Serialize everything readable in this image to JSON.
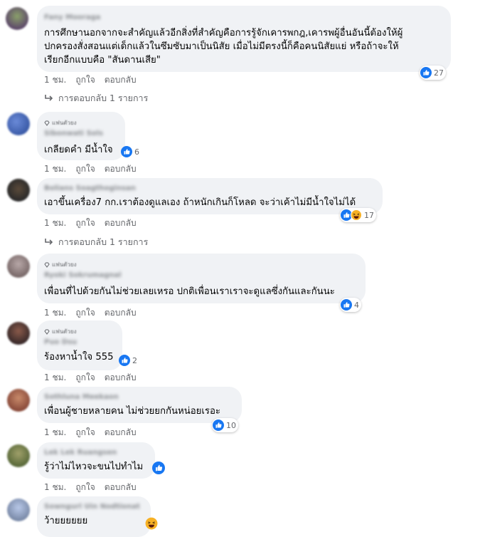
{
  "actions": {
    "time": "1 ชม.",
    "like": "ถูกใจ",
    "reply": "ตอบกลับ"
  },
  "comments": [
    {
      "author": "Fany Mooraga",
      "badge": "",
      "lines": [
        "การศึกษานอกจากจะสำคัญแล้วอีกสิ่งที่สำคัญคือการรู้จักเคารพกฎ,เคารพผู้อื่นอันนี้ต้องให้ผู้",
        "ปกครองสั่งสอนแต่เด็กแล้วในซึมซับมาเป็นนิสัย เมื่อไม่มีตรงนี้ก็คือคนนิสัยแย่ หรือถ้าจะให้",
        "เรียกอีกแบบคือ \"สันดานเสีย\""
      ],
      "reaction_count": "27",
      "replies_label": "การตอบกลับ 1 รายการ"
    },
    {
      "author": "Sibonwati Sols",
      "badge": "แฟนตัวยง",
      "lines": [
        "เกลียดคำ มีน้ำใจ"
      ],
      "reaction_count": "6",
      "replies_label": ""
    },
    {
      "author": "Bolians Soagthoginsan",
      "badge": "",
      "lines": [
        "เอาขึ้นเครื่อง7 กก.เราต้องดูแลเอง ถ้าหนักเกินก็โหลด จะว่าเค้าไม่มีน้ำใจไม่ได้"
      ],
      "reaction_count": "17",
      "replies_label": "การตอบกลับ 1 รายการ"
    },
    {
      "author": "Ryoki Sokrumagnal",
      "badge": "แฟนตัวยง",
      "lines": [
        "เพื่อนที่ไปด้วยกันไม่ช่วยเลยเหรอ ปกติเพื่อนเราเราจะดูแลซึ่งกันและกันนะ"
      ],
      "reaction_count": "4",
      "replies_label": ""
    },
    {
      "author": "Puo Dsu",
      "badge": "แฟนตัวยง",
      "lines": [
        "ร้องหาน้ำใจ 555"
      ],
      "reaction_count": "2",
      "replies_label": ""
    },
    {
      "author": "Sothluna Meekaon",
      "badge": "",
      "lines": [
        "เพื่อนผู้ชายหลายคน ไม่ช่วยยกกันหน่อยเรอะ"
      ],
      "reaction_count": "10",
      "replies_label": ""
    },
    {
      "author": "Lek Lek Ruangsen",
      "badge": "",
      "lines": [
        "รู้ว่าไม่ไหวจะขนไปทำไม"
      ],
      "reaction_count": "",
      "replies_label": ""
    },
    {
      "author": "Sowngurl Uin Nodtionat",
      "badge": "",
      "lines": [
        "ว้ายยยยยย"
      ],
      "reaction_count": "",
      "replies_label": ""
    }
  ],
  "colors": {
    "bubble": "#f0f2f5",
    "like_blue": "#1877f2",
    "secondary_text": "#65676b"
  }
}
